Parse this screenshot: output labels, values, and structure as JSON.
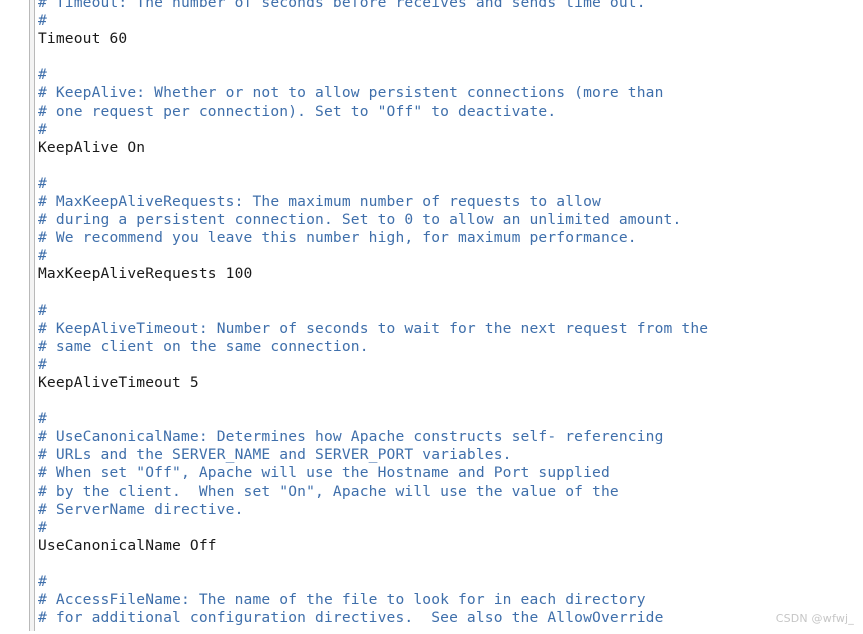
{
  "document": {
    "kind": "apache-httpd-config-text-view",
    "language": "apache-conf",
    "comment_color": "#3f6fab",
    "directive_color": "#1a1a1a",
    "background_color": "#ffffff",
    "lines": [
      {
        "type": "comment",
        "text": "# Timeout: The number of seconds before receives and sends time out."
      },
      {
        "type": "comment",
        "text": "#"
      },
      {
        "type": "directive",
        "text": "Timeout 60"
      },
      {
        "type": "blank",
        "text": ""
      },
      {
        "type": "comment",
        "text": "#"
      },
      {
        "type": "comment",
        "text": "# KeepAlive: Whether or not to allow persistent connections (more than"
      },
      {
        "type": "comment",
        "text": "# one request per connection). Set to \"Off\" to deactivate."
      },
      {
        "type": "comment",
        "text": "#"
      },
      {
        "type": "directive",
        "text": "KeepAlive On"
      },
      {
        "type": "blank",
        "text": ""
      },
      {
        "type": "comment",
        "text": "#"
      },
      {
        "type": "comment",
        "text": "# MaxKeepAliveRequests: The maximum number of requests to allow"
      },
      {
        "type": "comment",
        "text": "# during a persistent connection. Set to 0 to allow an unlimited amount."
      },
      {
        "type": "comment",
        "text": "# We recommend you leave this number high, for maximum performance."
      },
      {
        "type": "comment",
        "text": "#"
      },
      {
        "type": "directive",
        "text": "MaxKeepAliveRequests 100"
      },
      {
        "type": "blank",
        "text": ""
      },
      {
        "type": "comment",
        "text": "#"
      },
      {
        "type": "comment",
        "text": "# KeepAliveTimeout: Number of seconds to wait for the next request from the"
      },
      {
        "type": "comment",
        "text": "# same client on the same connection."
      },
      {
        "type": "comment",
        "text": "#"
      },
      {
        "type": "directive",
        "text": "KeepAliveTimeout 5"
      },
      {
        "type": "blank",
        "text": ""
      },
      {
        "type": "comment",
        "text": "#"
      },
      {
        "type": "comment",
        "text": "# UseCanonicalName: Determines how Apache constructs self- referencing"
      },
      {
        "type": "comment",
        "text": "# URLs and the SERVER_NAME and SERVER_PORT variables."
      },
      {
        "type": "comment",
        "text": "# When set \"Off\", Apache will use the Hostname and Port supplied"
      },
      {
        "type": "comment",
        "text": "# by the client.  When set \"On\", Apache will use the value of the"
      },
      {
        "type": "comment",
        "text": "# ServerName directive."
      },
      {
        "type": "comment",
        "text": "#"
      },
      {
        "type": "directive",
        "text": "UseCanonicalName Off"
      },
      {
        "type": "blank",
        "text": ""
      },
      {
        "type": "comment",
        "text": "#"
      },
      {
        "type": "comment",
        "text": "# AccessFileName: The name of the file to look for in each directory"
      },
      {
        "type": "comment",
        "text": "# for additional configuration directives.  See also the AllowOverride"
      }
    ]
  },
  "watermark": {
    "text": "CSDN @wfwj_",
    "color": "#c6c6c6"
  }
}
